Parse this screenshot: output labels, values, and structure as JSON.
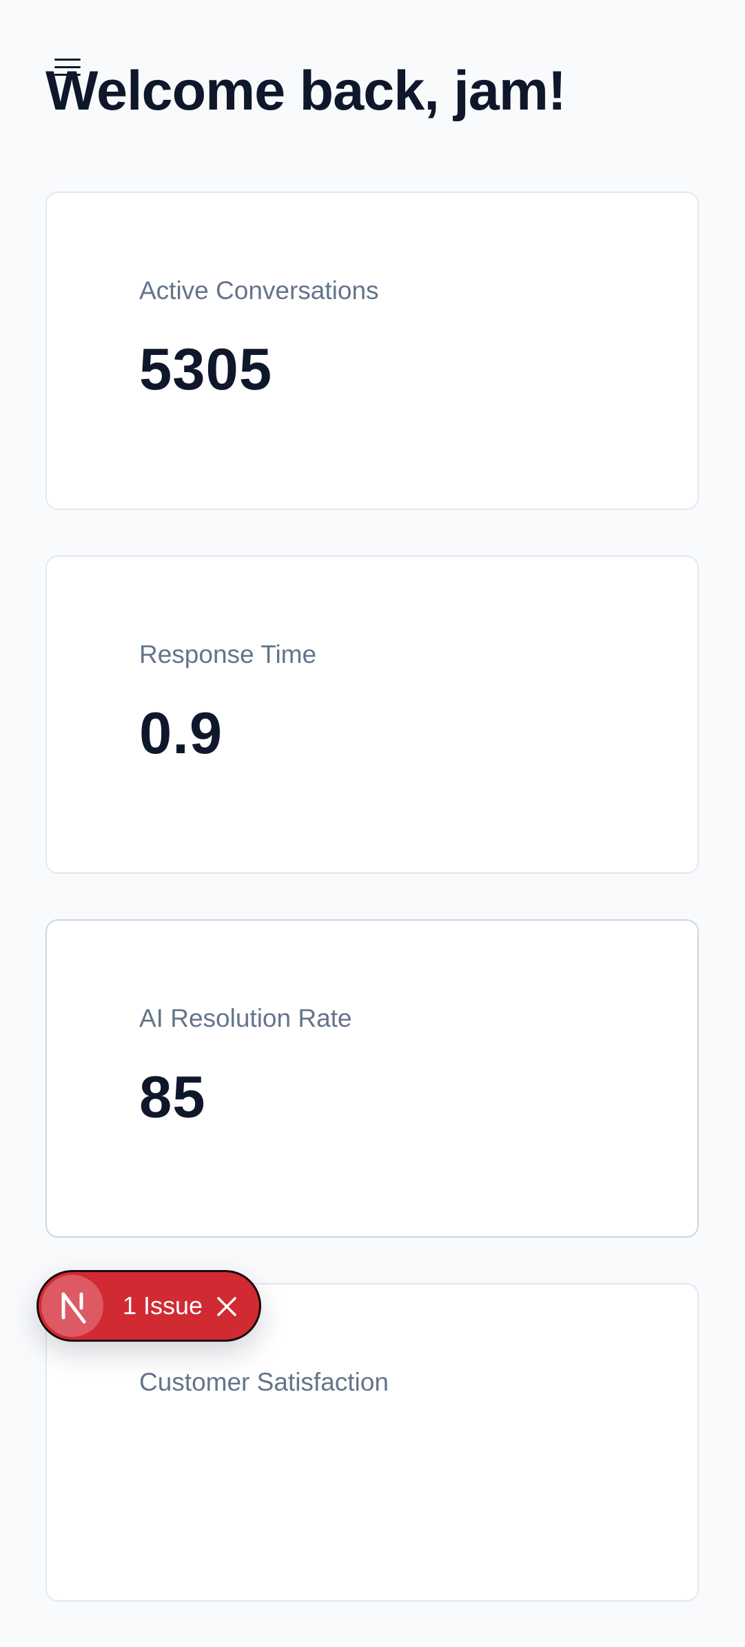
{
  "header": {
    "title": "Welcome back, jam!",
    "menu_icon": "hamburger-menu-icon"
  },
  "stats": [
    {
      "label": "Active Conversations",
      "value": "5305"
    },
    {
      "label": "Response Time",
      "value": "0.9"
    },
    {
      "label": "AI Resolution Rate",
      "value": "85"
    },
    {
      "label": "Customer Satisfaction",
      "value": ""
    }
  ],
  "issue_badge": {
    "label": "1 Issue",
    "logo_icon": "nextjs-logo-icon",
    "close_icon": "close-icon",
    "color": "#d12a33"
  },
  "colors": {
    "background": "#f8fafc",
    "text_primary": "#0f172a",
    "text_muted": "#64748b",
    "card_border": "#e2e8f0"
  }
}
